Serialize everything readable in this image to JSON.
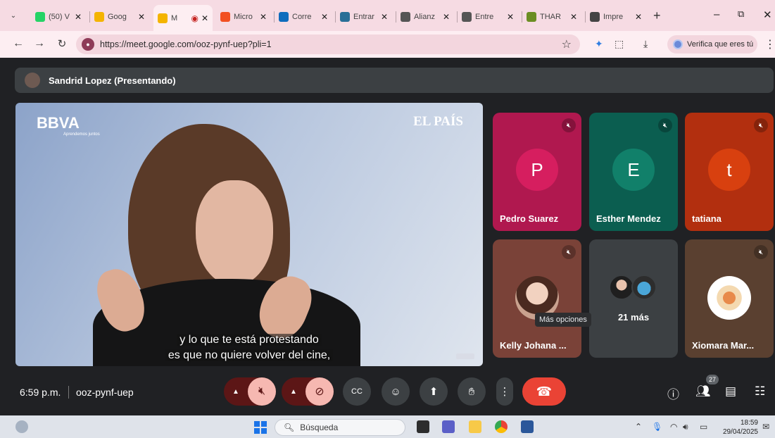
{
  "browser": {
    "tabs": [
      {
        "label": "(50) V",
        "fav": "whatsapp-icon",
        "color": "#25d366"
      },
      {
        "label": "Goog",
        "fav": "classroom-icon",
        "color": "#f4b400"
      },
      {
        "label": "M",
        "fav": "meet-icon",
        "color": "#f4b400",
        "active": true
      },
      {
        "label": "Micro",
        "fav": "microsoft-icon",
        "color": "#f25022"
      },
      {
        "label": "Corre",
        "fav": "outlook-icon",
        "color": "#0f6cbd"
      },
      {
        "label": "Entrar",
        "fav": "sharepoint-icon",
        "color": "#2a6f97"
      },
      {
        "label": "Alianz",
        "fav": "edge-icon",
        "color": "#555555"
      },
      {
        "label": "Entre",
        "fav": "edge-icon",
        "color": "#555555"
      },
      {
        "label": "THAR",
        "fav": "thar-icon",
        "color": "#6b8e23"
      },
      {
        "label": "Impre",
        "fav": "globe-icon",
        "color": "#444444"
      }
    ],
    "url": "https://meet.google.com/ooz-pynf-uep?pli=1",
    "profile_label": "Verifica que eres tú"
  },
  "meet": {
    "presenter": "Sandrid Lopez (Presentando)",
    "video": {
      "brand_left": "BBVA",
      "brand_left_sub": "Aprendemos juntos",
      "brand_right": "EL PAÍS",
      "caption_line1": "y lo que te está protestando",
      "caption_line2": "es que no quiere volver del cine,"
    },
    "participants": [
      {
        "name": "Pedro Suarez",
        "initial": "P",
        "bg": "#b0184f",
        "circle": "#d61e5f"
      },
      {
        "name": "Esther Mendez",
        "initial": "E",
        "bg": "#0b5e50",
        "circle": "#11806a"
      },
      {
        "name": "tatiana",
        "initial": "t",
        "bg": "#b22f0f",
        "circle": "#d8400f"
      },
      {
        "name": "Kelly Johana ...",
        "bg": "#7a4238"
      },
      {
        "name": "Xiomara Mar...",
        "bg": "#5a4030"
      }
    ],
    "more_count_label": "21 más",
    "tooltip": "Más opciones",
    "clock": "6:59 p.m.",
    "meeting_code": "ooz-pynf-uep",
    "people_count": "27"
  },
  "taskbar": {
    "search_placeholder": "Búsqueda",
    "time": "18:59",
    "date": "29/04/2025"
  }
}
